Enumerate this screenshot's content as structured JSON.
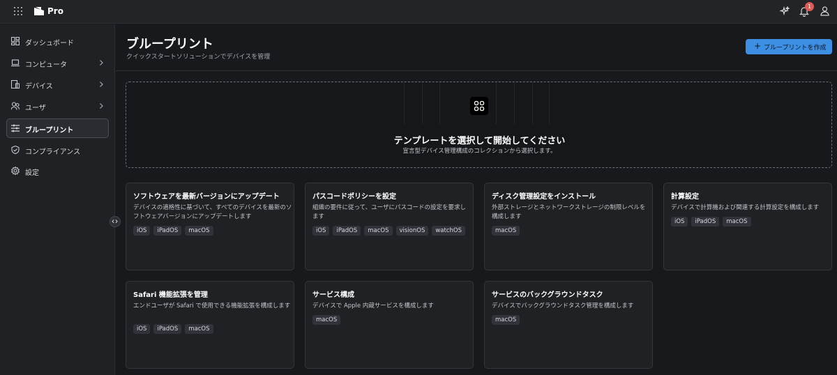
{
  "topbar": {
    "brand": "Pro",
    "notification_count": "1",
    "icons": [
      "apps-grid-icon",
      "logo-icon",
      "ai-sparkle-icon",
      "bell-icon",
      "user-icon"
    ]
  },
  "sidebar": {
    "items": [
      {
        "label": "ダッシュボード",
        "icon": "dashboard-icon"
      },
      {
        "label": "コンピュータ",
        "icon": "laptop-icon"
      },
      {
        "label": "デバイス",
        "icon": "devices-icon"
      },
      {
        "label": "ユーザ",
        "icon": "users-icon"
      },
      {
        "label": "ブループリント",
        "icon": "sliders-icon"
      },
      {
        "label": "コンプライアンス",
        "icon": "shield-check-icon"
      },
      {
        "label": "設定",
        "icon": "gear-icon"
      }
    ]
  },
  "header": {
    "title": "ブループリント",
    "subtitle": "クイックスタートソリューションでデバイスを管理",
    "create_label": "ブループリントを作成"
  },
  "empty_state": {
    "title": "テンプレートを選択して開始してください",
    "description": "宣言型デバイス管理構成のコレクションから選択します。"
  },
  "templates": [
    {
      "title": "ソフトウェアを最新バージョンにアップデート",
      "description": "デバイスの適格性に基づいて、すべてのデバイスを最新のソフトウェアバージョンにアップデートします",
      "platforms": [
        "iOS",
        "iPadOS",
        "macOS"
      ]
    },
    {
      "title": "パスコードポリシーを設定",
      "description": "組織の要件に従って、ユーザにパスコードの設定を要求します",
      "platforms": [
        "iOS",
        "iPadOS",
        "macOS",
        "visionOS",
        "watchOS"
      ]
    },
    {
      "title": "ディスク管理設定をインストール",
      "description": "外部ストレージとネットワークストレージの制限レベルを構成します",
      "platforms": [
        "macOS"
      ]
    },
    {
      "title": "計算設定",
      "description": "デバイスで計算機および関連する計算設定を構成します",
      "platforms": [
        "iOS",
        "iPadOS",
        "macOS"
      ]
    },
    {
      "title": "Safari 機能拡張を管理",
      "description": "エンドユーザが Safari で使用できる機能拡張を構成します",
      "platforms": [
        "iOS",
        "iPadOS",
        "macOS"
      ]
    },
    {
      "title": "サービス構成",
      "description": "デバイスで Apple 内蔵サービスを構成します",
      "platforms": [
        "macOS"
      ]
    },
    {
      "title": "サービスのバックグラウンドタスク",
      "description": "デバイスでバックグラウンドタスク管理を構成します",
      "platforms": [
        "macOS"
      ]
    }
  ]
}
